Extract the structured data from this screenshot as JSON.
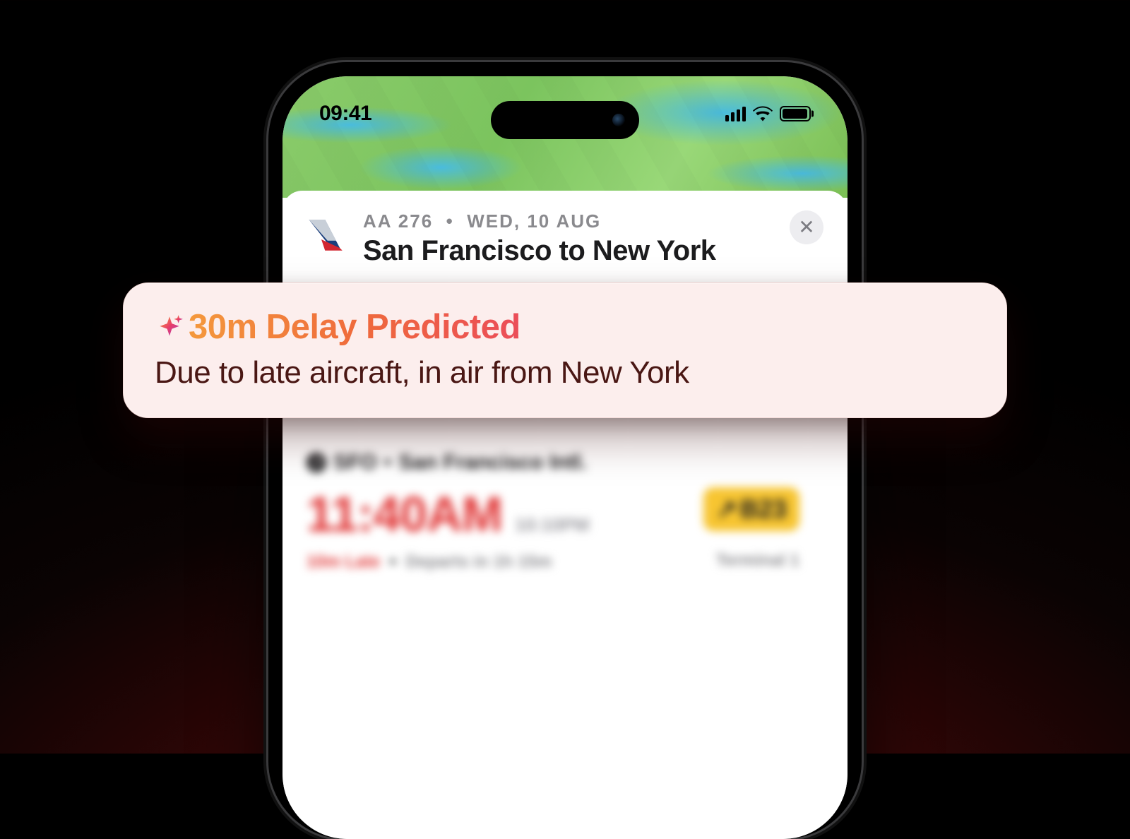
{
  "status": {
    "time": "09:41"
  },
  "card": {
    "flight_code": "AA 276",
    "date_label": "WED, 10 AUG",
    "route": "San Francisco to New York"
  },
  "prediction": {
    "headline": "30m Delay Predicted",
    "reason": "Due to late aircraft, in air from New York"
  },
  "departure": {
    "airport_code": "SFO",
    "airport_name": "San Francisco Intl.",
    "time": "11:40AM",
    "original_time": "10:10PM",
    "late_by": "10m Late",
    "departs_in": "Departs in 1h 15m",
    "gate": "B23",
    "terminal": "Terminal 1"
  },
  "colors": {
    "delay_red": "#e03636",
    "gate_yellow": "#f7c531",
    "callout_bg": "#fceeed"
  }
}
